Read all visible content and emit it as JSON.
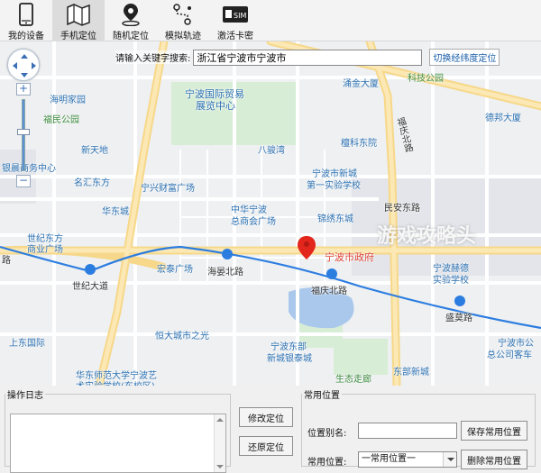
{
  "toolbar": {
    "items": [
      {
        "label": "我的设备",
        "icon": "phone-icon"
      },
      {
        "label": "手机定位",
        "icon": "map-icon"
      },
      {
        "label": "随机定位",
        "icon": "random-pin-icon"
      },
      {
        "label": "模拟轨迹",
        "icon": "route-icon"
      },
      {
        "label": "激活卡密",
        "icon": "sim-card-icon"
      }
    ],
    "active_index": 1
  },
  "search": {
    "label": "请输入关键字搜索:",
    "value": "浙江省宁波市宁波市",
    "switch_link": "切换经纬度定位"
  },
  "map": {
    "labels": [
      {
        "text": "涌金大厦",
        "cls": "blue"
      },
      {
        "text": "科技公园",
        "cls": "green"
      },
      {
        "text": "海明家园",
        "cls": "blue"
      },
      {
        "text": "宁波国际贸易",
        "cls": "blue big"
      },
      {
        "text": "展览中心",
        "cls": "blue big"
      },
      {
        "text": "福民公园",
        "cls": "green"
      },
      {
        "text": "德邦大厦",
        "cls": "blue"
      },
      {
        "text": "福庆北路",
        "cls": "road"
      },
      {
        "text": "檀科东院",
        "cls": "blue"
      },
      {
        "text": "新天地",
        "cls": "blue"
      },
      {
        "text": "八骏湾",
        "cls": "blue"
      },
      {
        "text": "银晨商务中心",
        "cls": "blue"
      },
      {
        "text": "名汇东方",
        "cls": "blue"
      },
      {
        "text": "宁兴财富广场",
        "cls": "blue"
      },
      {
        "text": "宁波市新城",
        "cls": "blue"
      },
      {
        "text": "第一实验学校",
        "cls": "blue"
      },
      {
        "text": "民安东路",
        "cls": "road"
      },
      {
        "text": "华东城",
        "cls": "blue"
      },
      {
        "text": "中华宁波",
        "cls": "blue"
      },
      {
        "text": "总商会广场",
        "cls": "blue"
      },
      {
        "text": "锦绣东城",
        "cls": "blue"
      },
      {
        "text": "世纪东方",
        "cls": "blue"
      },
      {
        "text": "商业广场",
        "cls": "blue"
      },
      {
        "text": "宁波市政府",
        "cls": "red big"
      },
      {
        "text": "宁波赫德",
        "cls": "blue"
      },
      {
        "text": "实验学校",
        "cls": "blue"
      },
      {
        "text": "宏泰广场",
        "cls": "blue"
      },
      {
        "text": "海晏北路",
        "cls": "road"
      },
      {
        "text": "世纪大道",
        "cls": "road"
      },
      {
        "text": "福庆北路",
        "cls": "road"
      },
      {
        "text": "盛莫路",
        "cls": "road"
      },
      {
        "text": "上东国际",
        "cls": "blue"
      },
      {
        "text": "恒大城市之光",
        "cls": "blue"
      },
      {
        "text": "宁波东部",
        "cls": "blue"
      },
      {
        "text": "新城银泰城",
        "cls": "blue"
      },
      {
        "text": "宁波市公",
        "cls": "blue"
      },
      {
        "text": "总公司客车",
        "cls": "blue"
      },
      {
        "text": "华东师范大学宁波艺",
        "cls": "blue"
      },
      {
        "text": "术实验学校(东校区)",
        "cls": "blue"
      },
      {
        "text": "生态走廊",
        "cls": "green"
      },
      {
        "text": "东部新城",
        "cls": "blue"
      },
      {
        "text": "路",
        "cls": "road"
      }
    ],
    "watermark": "游戏攻略头"
  },
  "log": {
    "legend": "操作日志",
    "modify_btn": "修改定位",
    "restore_btn": "还原定位"
  },
  "favorites": {
    "legend": "常用位置",
    "alias_label": "位置别名:",
    "save_btn": "保存常用位置",
    "select_label": "常用位置:",
    "select_value": "一常用位置一",
    "delete_btn": "删除常用位置"
  }
}
